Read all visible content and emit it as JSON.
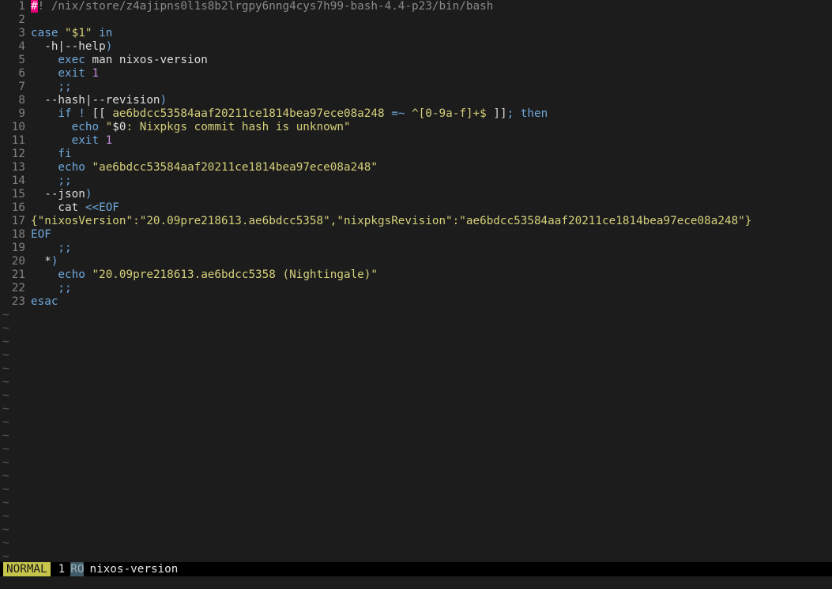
{
  "editor": {
    "lines": [
      {
        "n": "1",
        "tokens": [
          {
            "t": "#",
            "c": "cursor"
          },
          {
            "t": "! /nix/store/z4ajipns0l1s8b2lrgpy6nng4cys7h99-bash-4.4-p23/bin/bash",
            "c": "comment"
          }
        ]
      },
      {
        "n": "2",
        "tokens": []
      },
      {
        "n": "3",
        "tokens": [
          {
            "t": "case ",
            "c": "keyword"
          },
          {
            "t": "\"$1\"",
            "c": "string"
          },
          {
            "t": " in",
            "c": "keyword"
          }
        ]
      },
      {
        "n": "4",
        "tokens": [
          {
            "t": "  -h|--help",
            "c": "plain"
          },
          {
            "t": ")",
            "c": "op"
          }
        ]
      },
      {
        "n": "5",
        "tokens": [
          {
            "t": "    exec",
            "c": "keyword"
          },
          {
            "t": " man nixos-version",
            "c": "plain"
          }
        ]
      },
      {
        "n": "6",
        "tokens": [
          {
            "t": "    exit",
            "c": "keyword"
          },
          {
            "t": " 1",
            "c": "number"
          }
        ]
      },
      {
        "n": "7",
        "tokens": [
          {
            "t": "    ;;",
            "c": "op"
          }
        ]
      },
      {
        "n": "8",
        "tokens": [
          {
            "t": "  --hash|--revision",
            "c": "plain"
          },
          {
            "t": ")",
            "c": "op"
          }
        ]
      },
      {
        "n": "9",
        "tokens": [
          {
            "t": "    if",
            "c": "keyword"
          },
          {
            "t": " ! ",
            "c": "op"
          },
          {
            "t": "[[ ",
            "c": "plain"
          },
          {
            "t": "ae6bdcc53584aaf20211ce1814bea97ece08a248",
            "c": "string"
          },
          {
            "t": " =~ ",
            "c": "op"
          },
          {
            "t": "^[0-9a-f]+$",
            "c": "string"
          },
          {
            "t": " ]]",
            "c": "plain"
          },
          {
            "t": "; then",
            "c": "keyword"
          }
        ]
      },
      {
        "n": "10",
        "tokens": [
          {
            "t": "      echo",
            "c": "keyword"
          },
          {
            "t": " \"",
            "c": "string"
          },
          {
            "t": "$0",
            "c": "var"
          },
          {
            "t": ": Nixpkgs commit hash is unknown\"",
            "c": "string"
          }
        ]
      },
      {
        "n": "11",
        "tokens": [
          {
            "t": "      exit",
            "c": "keyword"
          },
          {
            "t": " 1",
            "c": "number"
          }
        ]
      },
      {
        "n": "12",
        "tokens": [
          {
            "t": "    fi",
            "c": "keyword"
          }
        ]
      },
      {
        "n": "13",
        "tokens": [
          {
            "t": "    echo",
            "c": "keyword"
          },
          {
            "t": " \"ae6bdcc53584aaf20211ce1814bea97ece08a248\"",
            "c": "string"
          }
        ]
      },
      {
        "n": "14",
        "tokens": [
          {
            "t": "    ;;",
            "c": "op"
          }
        ]
      },
      {
        "n": "15",
        "tokens": [
          {
            "t": "  --json",
            "c": "plain"
          },
          {
            "t": ")",
            "c": "op"
          }
        ]
      },
      {
        "n": "16",
        "tokens": [
          {
            "t": "    cat ",
            "c": "plain"
          },
          {
            "t": "<<EOF",
            "c": "op"
          }
        ]
      },
      {
        "n": "17",
        "tokens": [
          {
            "t": "{\"nixosVersion\":\"20.09pre218613.ae6bdcc5358\",\"nixpkgsRevision\":\"ae6bdcc53584aaf20211ce1814bea97ece08a248\"}",
            "c": "string"
          }
        ]
      },
      {
        "n": "18",
        "tokens": [
          {
            "t": "EOF",
            "c": "op"
          }
        ]
      },
      {
        "n": "19",
        "tokens": [
          {
            "t": "    ;;",
            "c": "op"
          }
        ]
      },
      {
        "n": "20",
        "tokens": [
          {
            "t": "  *",
            "c": "plain"
          },
          {
            "t": ")",
            "c": "op"
          }
        ]
      },
      {
        "n": "21",
        "tokens": [
          {
            "t": "    echo",
            "c": "keyword"
          },
          {
            "t": " \"20.09pre218613.ae6bdcc5358 (Nightingale)\"",
            "c": "string"
          }
        ]
      },
      {
        "n": "22",
        "tokens": [
          {
            "t": "    ;;",
            "c": "op"
          }
        ]
      },
      {
        "n": "23",
        "tokens": [
          {
            "t": "esac",
            "c": "keyword"
          }
        ]
      }
    ],
    "empty_marker": "~",
    "empty_line_count": 19
  },
  "statusline": {
    "mode": "NORMAL",
    "buffer_number": "1",
    "readonly_flag": "RO",
    "filename": "nixos-version"
  },
  "colors": {
    "background": "#1c1c1c",
    "keyword": "#6fa8dc",
    "string": "#d4d07a",
    "number": "#c58bdb",
    "comment": "#8a8a8a",
    "cursor": "#e5007a",
    "mode_badge": "#c6c44a",
    "readonly_badge": "#3f5c68"
  }
}
